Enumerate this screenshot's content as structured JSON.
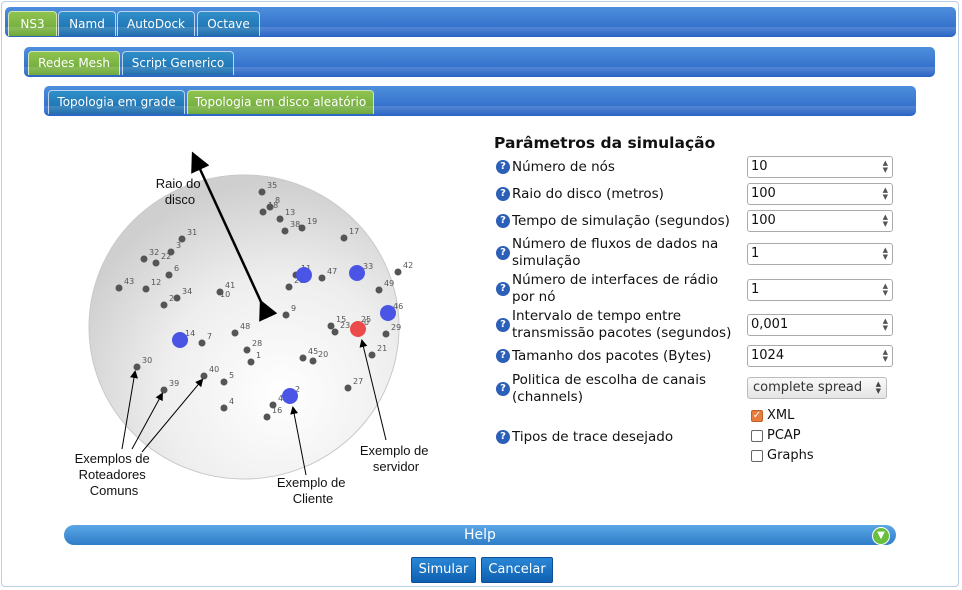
{
  "main_tabs": [
    "NS3",
    "Namd",
    "AutoDock",
    "Octave"
  ],
  "sub_tabs": [
    "Redes Mesh",
    "Script Generico"
  ],
  "topology_tabs": [
    "Topologia em grade",
    "Topologia em disco aleatório"
  ],
  "diagram": {
    "radius_label_line1": "Raio do",
    "radius_label_line2": "disco",
    "routers_label_line1": "Exemplos de",
    "routers_label_line2": "Roteadores",
    "routers_label_line3": "Comuns",
    "client_label_line1": "Exemplo de",
    "client_label_line2": "Cliente",
    "server_label_line1": "Exemplo de",
    "server_label_line2": "servidor",
    "nodes": [
      "35",
      "18",
      "8",
      "13",
      "38",
      "19",
      "31",
      "17",
      "32",
      "22",
      "3",
      "6",
      "43",
      "12",
      "34",
      "26",
      "41",
      "10",
      "11",
      "47",
      "33",
      "42",
      "49",
      "26",
      "46",
      "29",
      "9",
      "15",
      "23",
      "25",
      "0",
      "14",
      "7",
      "48",
      "28",
      "1",
      "21",
      "45",
      "20",
      "30",
      "39",
      "40",
      "5",
      "27",
      "4",
      "44",
      "2",
      "16"
    ]
  },
  "params": {
    "title": "Parâmetros da simulação",
    "help_symbol": "?",
    "nodes_label": "Número de nós",
    "nodes_value": "10",
    "radius_label": "Raio do disco (metros)",
    "radius_value": "100",
    "time_label": "Tempo de simulação (segundos)",
    "time_value": "100",
    "flows_label_line1": "Número de fluxos de dados na",
    "flows_label_line2": "simulação",
    "flows_value": "1",
    "interfaces_label_line1": "Número de interfaces de rádio",
    "interfaces_label_line2": "por nó",
    "interfaces_value": "1",
    "interval_label_line1": "Intervalo de tempo entre",
    "interval_label_line2": "transmissão pacotes (segundos)",
    "interval_value": "0,001",
    "packet_label": "Tamanho dos pacotes (Bytes)",
    "packet_value": "1024",
    "policy_label_line1": "Politica de escolha de canais",
    "policy_label_line2": "(channels)",
    "policy_value": "complete spread",
    "trace_label": "Tipos de trace desejado",
    "trace_options": [
      "XML",
      "PCAP",
      "Graphs"
    ]
  },
  "help_label": "Help",
  "buttons": {
    "submit": "Simular",
    "cancel": "Cancelar"
  }
}
